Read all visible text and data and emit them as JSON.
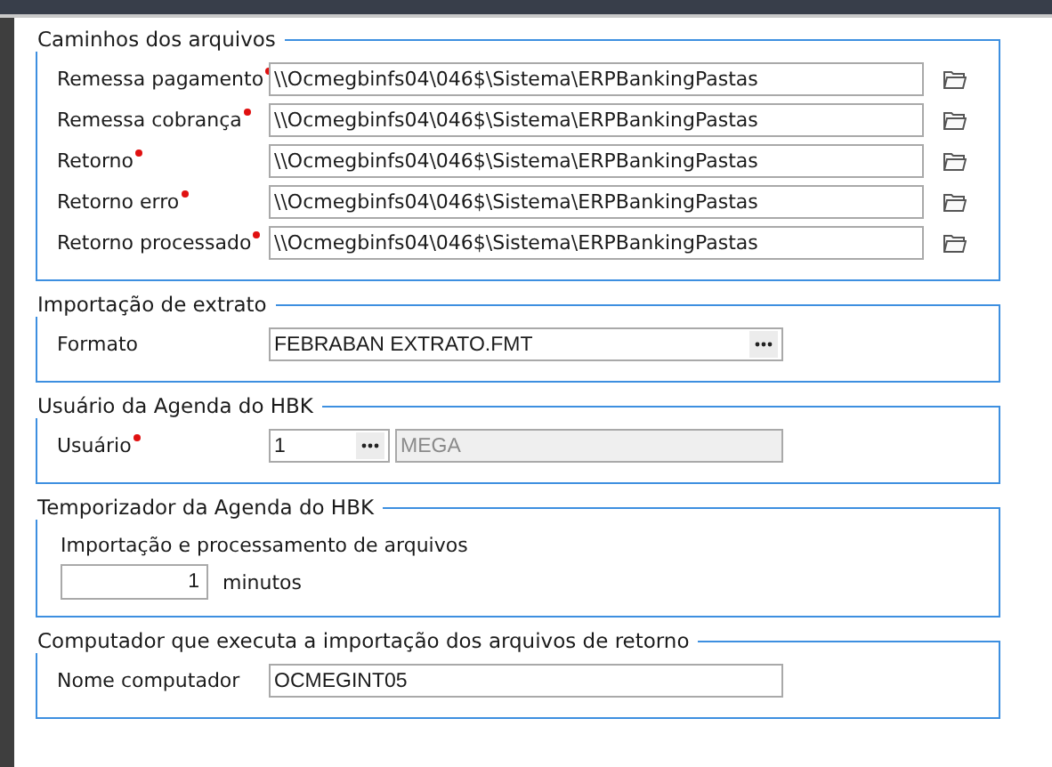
{
  "sections": [
    {
      "title": "Caminhos dos arquivos",
      "rows": [
        {
          "kind": "path",
          "label": "Remessa pagamento",
          "required": true,
          "value": "\\\\Ocmegbinfs04\\046$\\Sistema\\ERPBankingPastas"
        },
        {
          "kind": "path",
          "label": "Remessa cobrança",
          "required": true,
          "value": "\\\\Ocmegbinfs04\\046$\\Sistema\\ERPBankingPastas"
        },
        {
          "kind": "path",
          "label": "Retorno",
          "required": true,
          "value": "\\\\Ocmegbinfs04\\046$\\Sistema\\ERPBankingPastas"
        },
        {
          "kind": "path",
          "label": "Retorno erro",
          "required": true,
          "value": "\\\\Ocmegbinfs04\\046$\\Sistema\\ERPBankingPastas"
        },
        {
          "kind": "path",
          "label": "Retorno processado",
          "required": true,
          "value": "\\\\Ocmegbinfs04\\046$\\Sistema\\ERPBankingPastas"
        }
      ]
    },
    {
      "title": "Importação de extrato",
      "rows": [
        {
          "kind": "lookup",
          "label": "Formato",
          "required": false,
          "value": "FEBRABAN EXTRATO.FMT"
        }
      ]
    },
    {
      "title": "Usuário da Agenda do HBK",
      "rows": [
        {
          "kind": "lookup_pair",
          "label": "Usuário",
          "required": true,
          "value": "1",
          "description": {
            "value": "MEGA",
            "disabled": true
          }
        }
      ]
    },
    {
      "title": "Temporizador da Agenda do HBK",
      "rows": [
        {
          "kind": "interval",
          "label": "Importação e processamento de arquivos",
          "value": "1",
          "unit": "minutos"
        }
      ]
    },
    {
      "title": "Computador que executa a importação dos arquivos de retorno",
      "rows": [
        {
          "kind": "text",
          "label": "Nome computador",
          "required": false,
          "value": "OCMEGINT05"
        }
      ]
    }
  ]
}
